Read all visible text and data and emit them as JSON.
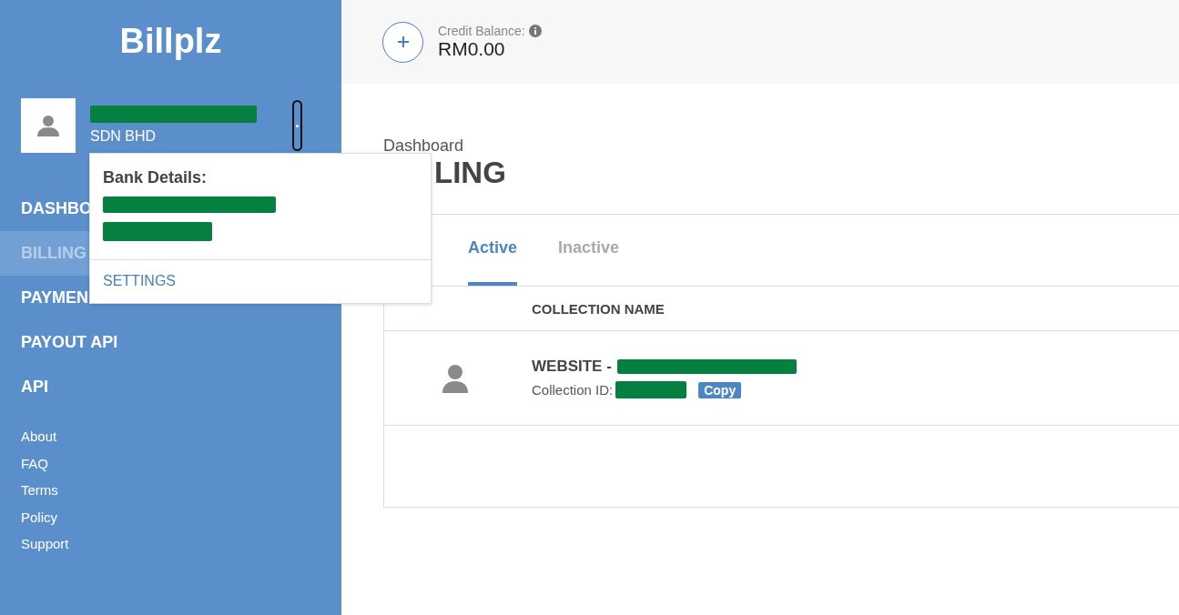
{
  "sidebar": {
    "logo": "Billplz",
    "account": {
      "company_suffix": "SDN BHD"
    },
    "nav": [
      {
        "label": "DASHBO",
        "selected": false
      },
      {
        "label": "BILLING",
        "selected": true
      },
      {
        "label": "PAYMEN",
        "selected": false
      },
      {
        "label": "PAYOUT API",
        "selected": false
      },
      {
        "label": "API",
        "selected": false
      }
    ],
    "links": [
      "About",
      "FAQ",
      "Terms",
      "Policy",
      "Support"
    ]
  },
  "account_popup": {
    "title": "Bank Details:",
    "settings_link": "SETTINGS"
  },
  "header": {
    "credit_label": "Credit Balance:",
    "credit_value": "RM0.00"
  },
  "page": {
    "breadcrumb": "Dashboard",
    "title": "LING"
  },
  "tabs": [
    {
      "label": "Active",
      "selected": true
    },
    {
      "label": "Inactive",
      "selected": false
    }
  ],
  "table": {
    "columns": [
      "COLLECTION NAME"
    ],
    "rows": [
      {
        "name_prefix": "WEBSITE -",
        "id_label": "Collection ID:",
        "copy_button": "Copy"
      }
    ]
  }
}
